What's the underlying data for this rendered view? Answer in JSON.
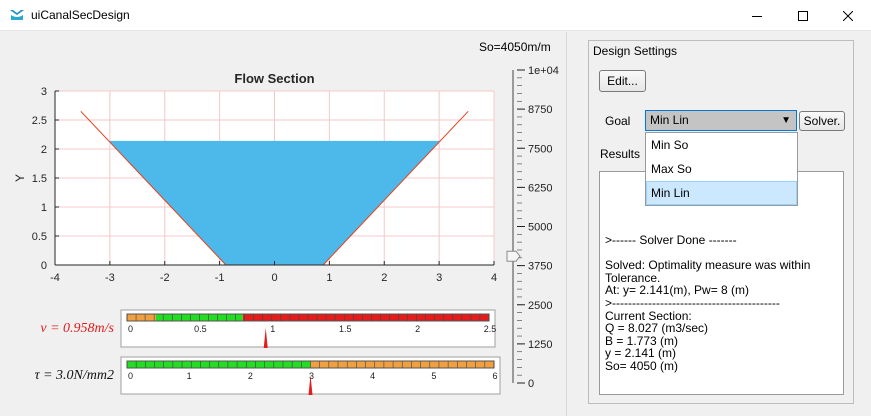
{
  "window": {
    "title": "uiCanalSecDesign",
    "colors": {
      "titlebar": "#ffffff",
      "accent": "#0078d7"
    }
  },
  "plot": {
    "slope_label": "So=4050m/m",
    "chart_data": {
      "type": "area",
      "title": "Flow Section",
      "xlabel": "",
      "ylabel": "Y",
      "xlim": [
        -4,
        4
      ],
      "ylim": [
        0,
        3
      ],
      "x_ticks": [
        "-4",
        "-3",
        "-2",
        "-1",
        "0",
        "1",
        "2",
        "3",
        "4"
      ],
      "y_ticks": [
        "0",
        "0.5",
        "1",
        "1.5",
        "2",
        "2.5",
        "3"
      ],
      "grid": true,
      "bank_line": {
        "x": [
          -3.53,
          -0.886,
          0.886,
          3.53
        ],
        "y": [
          2.65,
          0,
          0,
          2.65
        ],
        "color": "#e8401c"
      },
      "water": {
        "x": [
          -3.027,
          -0.886,
          0.886,
          3.027
        ],
        "y": [
          2.141,
          0,
          0,
          2.141
        ],
        "color": "#4db8ea"
      }
    },
    "velocity_gauge": {
      "label": "v = 0.958m/s",
      "ticks": [
        "0",
        "0.5",
        "1",
        "1.5",
        "2",
        "2.5"
      ],
      "min": 0,
      "max": 2.5,
      "value": 0.958,
      "zones": [
        {
          "from": 0,
          "to": 0.2,
          "color": "#f0a040"
        },
        {
          "from": 0.2,
          "to": 0.8,
          "color": "#22dd22"
        },
        {
          "from": 0.8,
          "to": 2.5,
          "color": "#e41c1c"
        }
      ]
    },
    "shear_gauge": {
      "label": "τ = 3.0N/mm2",
      "ticks": [
        "0",
        "1",
        "2",
        "3",
        "4",
        "5",
        "6"
      ],
      "min": 0,
      "max": 6,
      "value": 3.0,
      "zones": [
        {
          "from": 0,
          "to": 3,
          "color": "#22dd22"
        },
        {
          "from": 3,
          "to": 6,
          "color": "#f0a040"
        }
      ]
    },
    "slope_slider": {
      "ticks": [
        "0",
        "1250",
        "2500",
        "3750",
        "5000",
        "6250",
        "7500",
        "8750",
        "1e+04"
      ],
      "min": 0,
      "max": 10000,
      "value": 4050
    }
  },
  "settings": {
    "panel_title": "Design Settings",
    "edit_label": "Edit...",
    "goal_label": "Goal",
    "goal_value": "Min Lin",
    "solver_label": "Solver.",
    "results_label": "Results",
    "results_text": ">------ Solver Done -------\n\nSolved: Optimality measure was within Tolerance.\nAt: y= 2.141(m), Pw= 8 (m)\n>------------------------------------------\nCurrent Section:\nQ = 8.027 (m3/sec)\nB = 1.773 (m)\ny = 2.141 (m)\nSo= 4050 (m)",
    "goal_options": [
      "Min So",
      "Max So",
      "Min Lin"
    ],
    "selected_option": "Min Lin"
  }
}
